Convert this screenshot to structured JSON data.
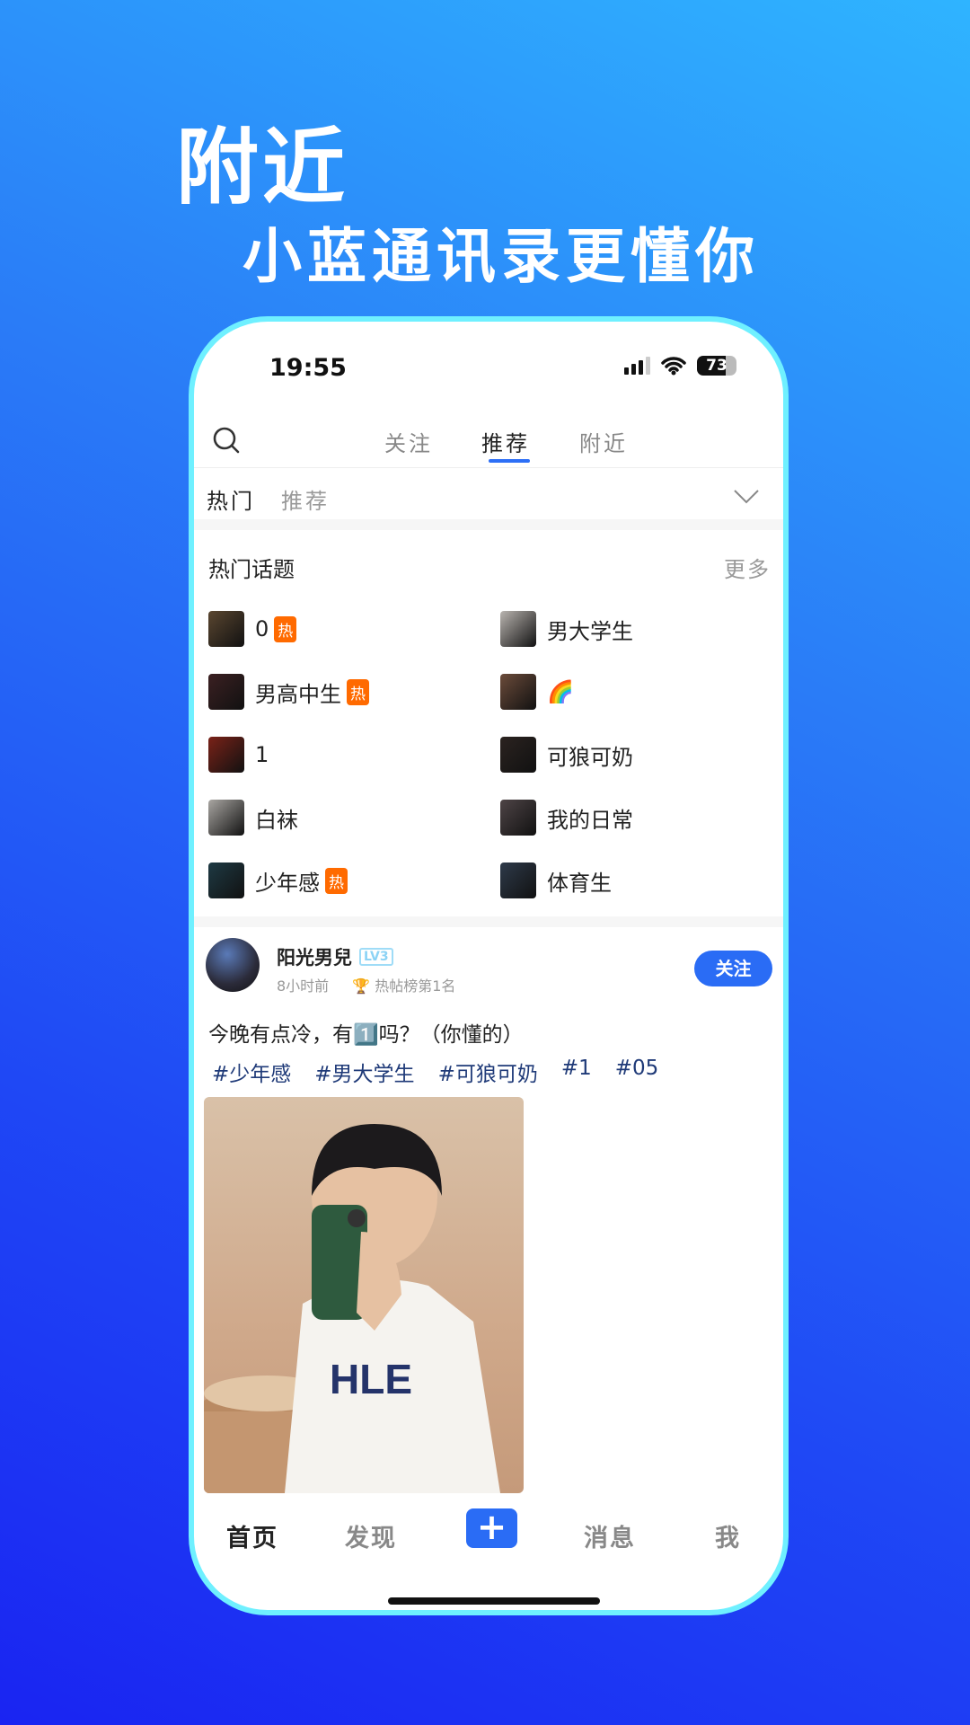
{
  "promo": {
    "title": "附近",
    "subtitle": "小蓝通讯录更懂你"
  },
  "status_bar": {
    "time": "19:55",
    "battery": "73"
  },
  "top_tabs": [
    {
      "label": "关注"
    },
    {
      "label": "推荐",
      "active": true
    },
    {
      "label": "附近"
    }
  ],
  "sub_tabs": [
    {
      "label": "热门",
      "active": true
    },
    {
      "label": "推荐"
    }
  ],
  "hot_topics": {
    "title": "热门话题",
    "more": "更多",
    "hot_badge": "热",
    "items": [
      {
        "label": "0",
        "hot": true,
        "thumb": "#5a4630"
      },
      {
        "label": "男大学生",
        "hot": false,
        "thumb": "#b9b4b0"
      },
      {
        "label": "男高中生",
        "hot": true,
        "thumb": "#3b2022"
      },
      {
        "label": "🌈",
        "hot": false,
        "thumb": "#6b4b3a"
      },
      {
        "label": "1",
        "hot": false,
        "thumb": "#7a2218"
      },
      {
        "label": "可狼可奶",
        "hot": false,
        "thumb": "#2b2320"
      },
      {
        "label": "白袜",
        "hot": false,
        "thumb": "#a9a6a2"
      },
      {
        "label": "我的日常",
        "hot": false,
        "thumb": "#4e4446"
      },
      {
        "label": "少年感",
        "hot": true,
        "thumb": "#1e3a44"
      },
      {
        "label": "体育生",
        "hot": false,
        "thumb": "#2e3a4a"
      }
    ]
  },
  "post": {
    "author": "阳光男兒",
    "level": "LV3",
    "time": "8小时前",
    "rank": "热帖榜第1名",
    "follow_label": "关注",
    "text": "今晚有点冷，有1️⃣吗？（你懂的）",
    "tags": [
      "#少年感",
      "#男大学生",
      "#可狼可奶",
      "#1",
      "#05"
    ]
  },
  "bottom_nav": [
    {
      "label": "首页",
      "active": true
    },
    {
      "label": "发现"
    },
    {
      "label": "+"
    },
    {
      "label": "消息"
    },
    {
      "label": "我"
    }
  ],
  "colors": {
    "accent": "#2a6cf5",
    "hot": "#ff6a00",
    "frame": "#6ff0ff",
    "tag": "#1f3a78"
  }
}
